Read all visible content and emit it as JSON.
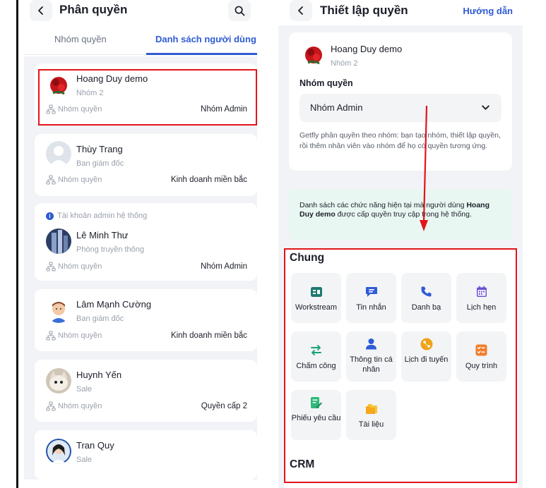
{
  "left": {
    "header": {
      "title": "Phân quyền"
    },
    "tabs": [
      {
        "label": "Nhóm quyền"
      },
      {
        "label": "Danh sách người dùng"
      }
    ],
    "group_label": "Nhóm quyền",
    "users": [
      {
        "name": "Hoang Duy demo",
        "role": "Nhóm 2",
        "group": "Nhóm Admin"
      },
      {
        "name": "Thùy Trang",
        "role": "Ban giám đốc",
        "group": "Kinh doanh miền bắc"
      },
      {
        "admin_note": "Tài khoản admin hệ thống",
        "name": "Lê Minh Thư",
        "role": "Phòng truyền thông",
        "group": "Nhóm Admin"
      },
      {
        "name": "Lâm Mạnh Cường",
        "role": "Ban giám đốc",
        "group": "Kinh doanh miền bắc"
      },
      {
        "name": "Huynh Yến",
        "role": "Sale",
        "group": "Quyền cấp 2"
      },
      {
        "name": "Tran Quy",
        "role": "Sale"
      }
    ]
  },
  "right": {
    "header": {
      "title": "Thiết lập quyền",
      "guide": "Hướng dẫn"
    },
    "profile": {
      "name": "Hoang Duy demo",
      "role": "Nhóm 2",
      "section_label": "Nhóm quyền",
      "selected_group": "Nhóm Admin",
      "description": "Getfly phân quyền theo nhóm: bạn tạo nhóm, thiết lập quyền, rồi thêm nhân viên vào nhóm để họ có quyền tương ứng."
    },
    "notice": {
      "before": "Danh sách các chức năng hiện tại mà người dùng ",
      "user": "Hoang Duy demo",
      "after": " được cấp quyền truy cập trong hệ thống."
    },
    "sections": [
      {
        "title": "Chung",
        "features": [
          {
            "label": "Workstream",
            "icon": "workstream-icon",
            "color": "#1f7a6e"
          },
          {
            "label": "Tin nhắn",
            "icon": "chat-icon",
            "color": "#2f5bd4"
          },
          {
            "label": "Danh bạ",
            "icon": "phone-icon",
            "color": "#2f5bd4"
          },
          {
            "label": "Lịch hẹn",
            "icon": "calendar-icon",
            "color": "#6b4fd8"
          },
          {
            "label": "Chấm công",
            "icon": "swap-arrows-icon",
            "color": "#16a37a"
          },
          {
            "label": "Thông tin cá nhân",
            "icon": "person-icon",
            "color": "#2f5bd4"
          },
          {
            "label": "Lịch đi tuyến",
            "icon": "route-icon",
            "color": "#f0a21a"
          },
          {
            "label": "Quy trình",
            "icon": "checklist-icon",
            "color": "#f07e2c"
          },
          {
            "label": "Phiếu yêu cầu",
            "icon": "request-form-icon",
            "color": "#2eb87a"
          },
          {
            "label": "Tài liệu",
            "icon": "folder-icon",
            "color": "#f5b51f"
          }
        ]
      },
      {
        "title": "CRM"
      }
    ]
  }
}
